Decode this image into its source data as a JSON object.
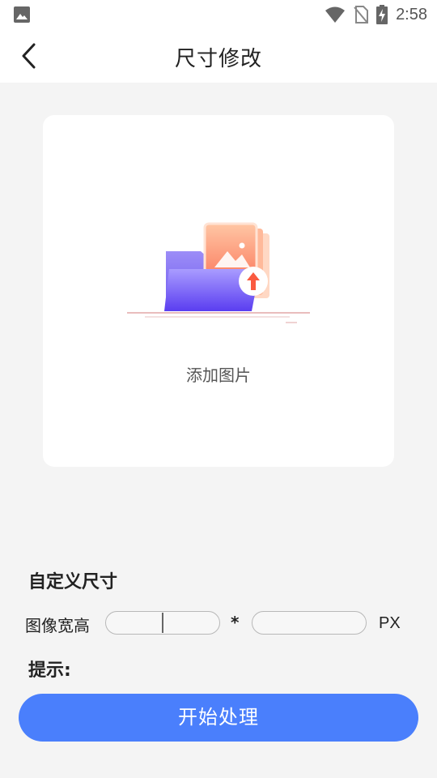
{
  "status_bar": {
    "time": "2:58",
    "icons": [
      "image-icon",
      "wifi-icon",
      "no-sim-icon",
      "battery-charging-icon"
    ]
  },
  "header": {
    "title": "尺寸修改",
    "back_icon": "chevron-left-icon"
  },
  "upload": {
    "label": "添加图片",
    "icon": "folder-image-upload-icon"
  },
  "custom_size": {
    "title": "自定义尺寸",
    "field_label": "图像宽高",
    "width_value": "",
    "separator": "*",
    "height_value": "",
    "unit": "PX"
  },
  "hint": {
    "title": "提示:"
  },
  "action": {
    "start_label": "开始处理"
  },
  "colors": {
    "primary": "#4a7ffc",
    "background": "#f4f4f4"
  }
}
